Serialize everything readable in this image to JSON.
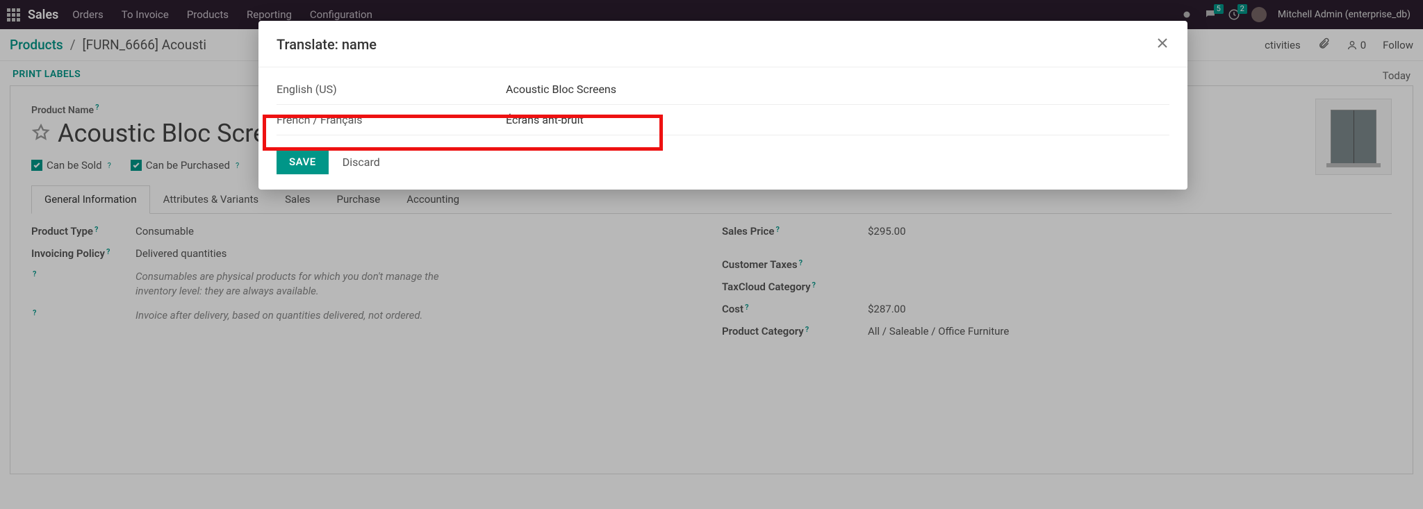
{
  "topnav": {
    "brand": "Sales",
    "menu": [
      "Orders",
      "To Invoice",
      "Products",
      "Reporting",
      "Configuration"
    ],
    "chat_badge": "5",
    "clock_badge": "2",
    "user_label": "Mitchell Admin (enterprise_db)"
  },
  "breadcrumb": {
    "root": "Products",
    "current": "[FURN_6666] Acousti",
    "followers_count": "0",
    "follow_label": "Follow",
    "activities_label": "ctivities"
  },
  "actions": {
    "print_labels": "PRINT LABELS"
  },
  "activities": {
    "today": "Today"
  },
  "product": {
    "name_label": "Product Name",
    "name": "Acoustic Bloc Screens",
    "can_sold": "Can be Sold",
    "can_purchased": "Can be Purchased",
    "tabs": [
      "General Information",
      "Attributes & Variants",
      "Sales",
      "Purchase",
      "Accounting"
    ],
    "left": {
      "type_label": "Product Type",
      "type_value": "Consumable",
      "invoicing_label": "Invoicing Policy",
      "invoicing_value": "Delivered quantities",
      "desc1": "Consumables are physical products for which you don't manage the inventory level: they are always available.",
      "desc2": "Invoice after delivery, based on quantities delivered, not ordered."
    },
    "right": {
      "sales_price_label": "Sales Price",
      "sales_price_value": "$295.00",
      "customer_taxes_label": "Customer Taxes",
      "taxcloud_label": "TaxCloud Category",
      "cost_label": "Cost",
      "cost_value": "$287.00",
      "category_label": "Product Category",
      "category_value": "All / Saleable / Office Furniture"
    }
  },
  "modal": {
    "title": "Translate: name",
    "rows": [
      {
        "lang": "English (US)",
        "value": "Acoustic Bloc Screens"
      },
      {
        "lang": "French / Français",
        "value": "Écrans ant-bruit"
      }
    ],
    "save": "SAVE",
    "discard": "Discard"
  }
}
